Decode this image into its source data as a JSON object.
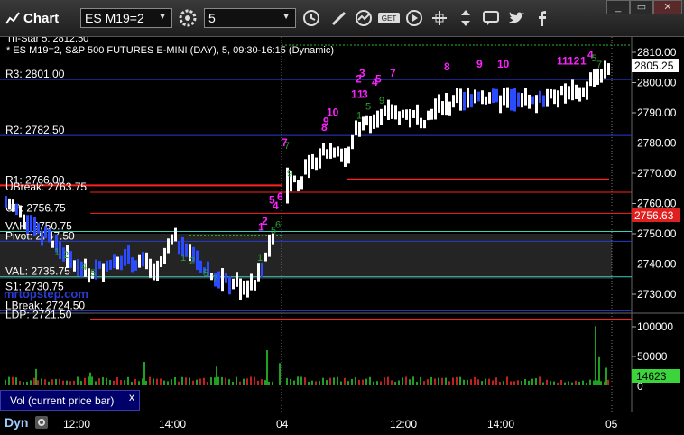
{
  "toolbar": {
    "app_title": "Chart",
    "symbol_value": "ES M19=2",
    "interval_value": "5",
    "icons": [
      "chart-icon",
      "gear-icon",
      "clock-icon",
      "pencil-icon",
      "indicator-icon",
      "get-icon",
      "play-icon",
      "crosshair-icon",
      "chat-icon",
      "twitter-icon",
      "facebook-icon"
    ],
    "window_controls": [
      "minimize",
      "maximize",
      "close"
    ]
  },
  "chart": {
    "header_line1": "Tri-Star 5: 2812.50",
    "header_line2": "* ES M19=2, S&P 500 FUTURES E-MINI (DAY), 5, 09:30-16:15 (Dynamic)",
    "price_ticks": [
      "2810.00",
      "2800.00",
      "2790.00",
      "2780.00",
      "2770.00",
      "2760.00",
      "2750.00",
      "2740.00",
      "2730.00"
    ],
    "last_price": "2805.25",
    "red_price": "2756.63",
    "levels": [
      {
        "label": "R3: 2801.00"
      },
      {
        "label": "R2: 2782.50"
      },
      {
        "label": "R1: 2766.00"
      },
      {
        "label": "UBreak: 2763.75"
      },
      {
        "label": "UP: 2756.75"
      },
      {
        "label": "VAH: 2750.75"
      },
      {
        "label": "Pivot: 2747.50"
      },
      {
        "label": "VAL: 2735.75"
      },
      {
        "label": "S1: 2730.75"
      },
      {
        "label": "LBreak: 2724.50"
      },
      {
        "label": "LDP: 2721.50"
      }
    ],
    "watermark": "mrtopstep.com",
    "time_ticks": [
      "12:00",
      "14:00",
      "04",
      "12:00",
      "14:00",
      "05"
    ],
    "colors": {
      "background": "#000000",
      "bar": "#ffffff",
      "down_bar": "#2a4bff",
      "level_blue": "#2a3bd0",
      "level_red": "#ff2020",
      "level_cyan": "#3ad0c0",
      "magenta": "#ff20ff",
      "green": "#22bb22",
      "last_price_bg": "#ffffff",
      "red_price_bg": "#e02020"
    }
  },
  "chart_data": {
    "type": "line",
    "title": "",
    "ylim": [
      2725,
      2815
    ],
    "levels": {
      "R3": 2801.0,
      "R2": 2782.5,
      "R1": 2766.0,
      "UBreak": 2763.75,
      "UP": 2756.75,
      "VAH": 2750.75,
      "Pivot": 2747.5,
      "VAL": 2735.75,
      "S1": 2730.75,
      "LBreak": 2724.5,
      "LDP": 2721.5
    },
    "last": 2805.25,
    "marker": 2756.63
  },
  "volume": {
    "ticks": [
      "100000",
      "50000",
      "0"
    ],
    "current": "14623",
    "label": "Vol (current price bar)",
    "close": "x"
  },
  "footer": {
    "dyn": "Dyn"
  }
}
